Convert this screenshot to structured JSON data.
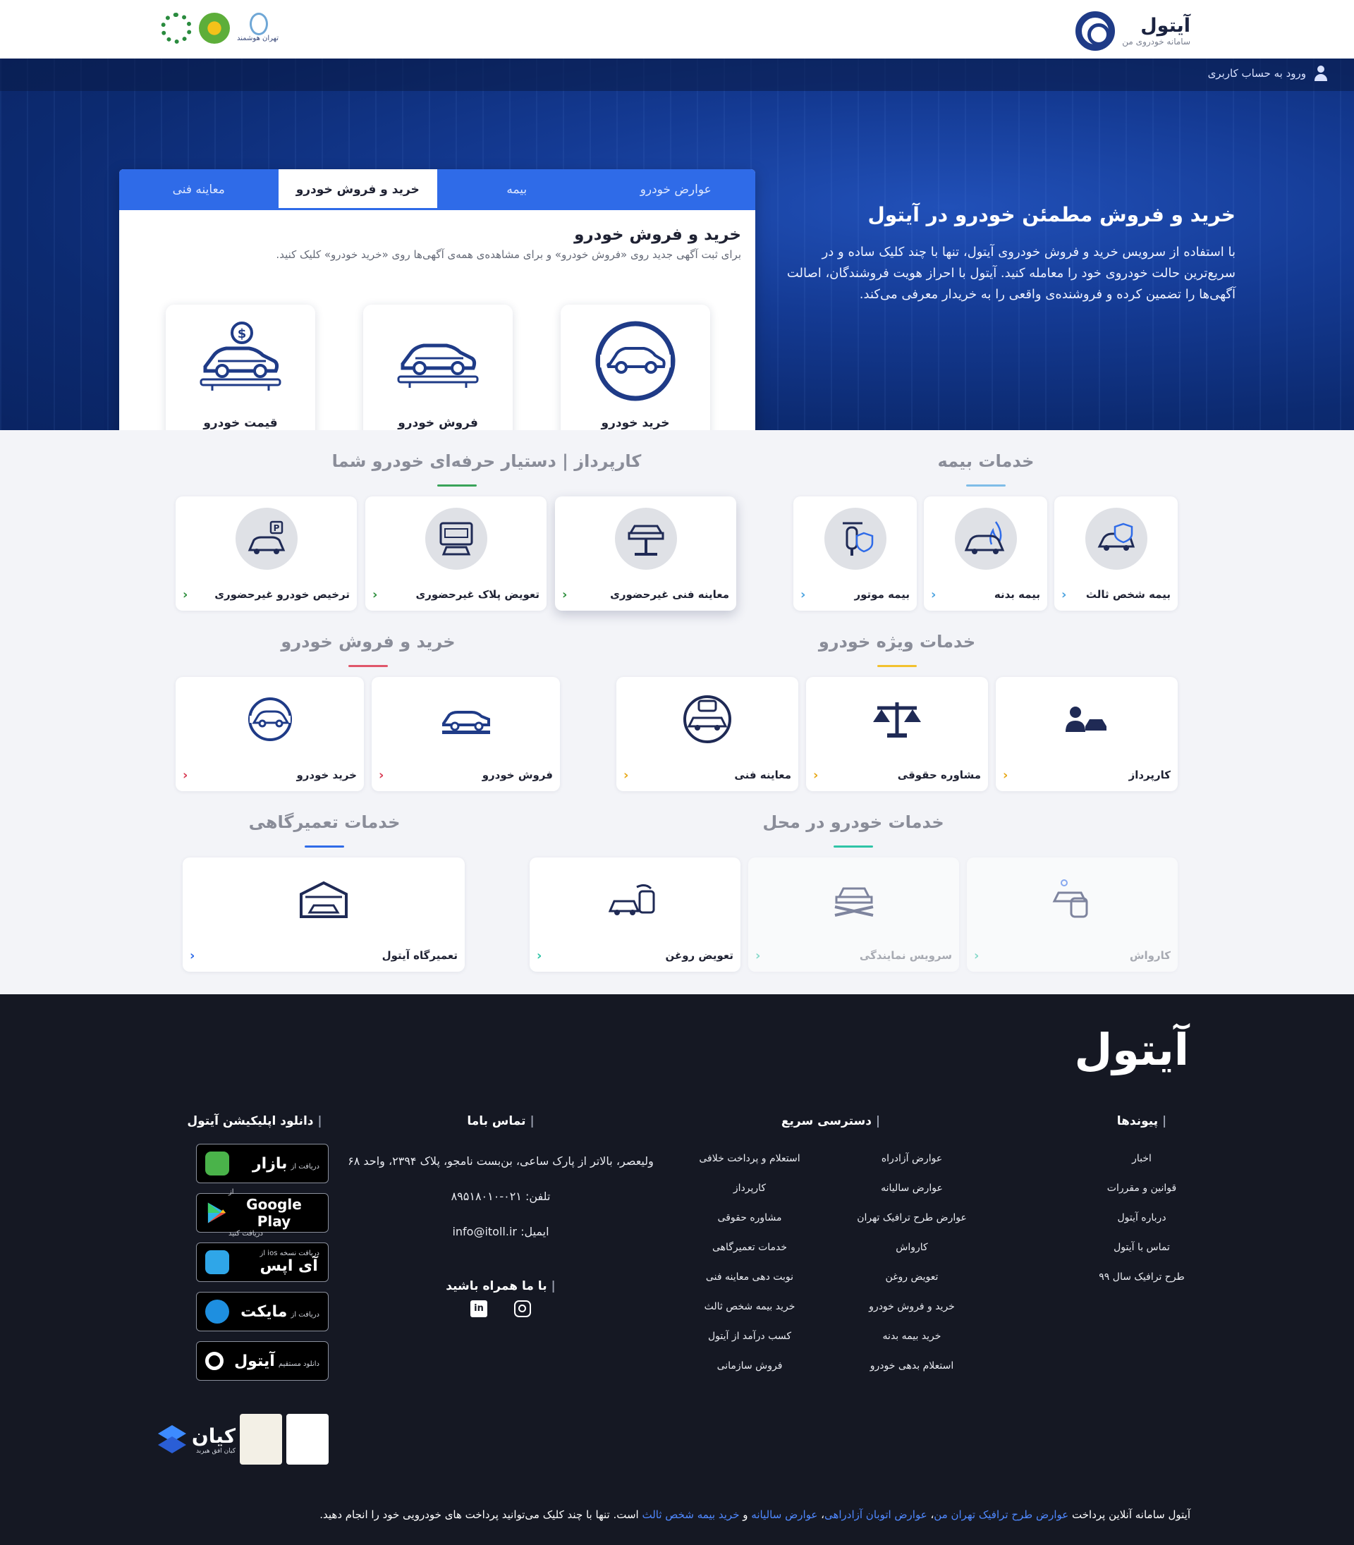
{
  "header": {
    "brand_name": "آیتول",
    "brand_tagline": "سامانه خودروی من",
    "partner_text": "تهران هوشمند"
  },
  "hero": {
    "login_label": "ورود به حساب کاربری",
    "title": "خرید و فروش مطمئن خودرو در آیتول",
    "description": "با استفاده از سرویس خرید و فروش خودروی آیتول، تنها با چند کلیک ساده و در سریع‌ترین حالت خودروی خود را معامله کنید. آیتول با احراز هویت فروشندگان، اصالت آگهی‌ها را تضمین کرده و فروشنده‌ی واقعی را به خریدار معرفی می‌کند."
  },
  "tabs": {
    "items": [
      "عوارض خودرو",
      "بیمه",
      "خرید و فروش خودرو",
      "معاینه فنی"
    ],
    "active_index": 2,
    "panel_title": "خرید و فروش خودرو",
    "panel_desc": "برای ثبت آگهی جدید روی «فروش خودرو» و برای مشاهده‌ی همه‌ی آگهی‌ها روی «خرید خودرو» کلیک کنید.",
    "cards": [
      "خرید خودرو",
      "فروش خودرو",
      "قیمت خودرو"
    ]
  },
  "sections": {
    "insurance": {
      "title": "خدمات بیمه",
      "accent": "#7fbde8",
      "items": [
        "بیمه شخص ثالث",
        "بیمه بدنه",
        "بیمه موتور"
      ]
    },
    "karpardaz": {
      "title": "کارپرداز | دستیار حرفه‌ای خودرو شما",
      "accent": "#3aa35a",
      "items": [
        "معاینه فنی غیرحضوری",
        "تعویض پلاک غیرحضوری",
        "ترخیص خودرو غیرحضوری"
      ]
    },
    "special": {
      "title": "خدمات ویژه خودرو",
      "accent": "#f2c12e",
      "items": [
        "کارپرداز",
        "مشاوره حقوقی",
        "معاینه فنی"
      ]
    },
    "trade": {
      "title": "خرید و فروش خودرو",
      "accent": "#e0566a",
      "items": [
        "فروش خودرو",
        "خرید خودرو"
      ]
    },
    "onsite": {
      "title": "خدمات خودرو در محل",
      "accent": "#2fc4a6",
      "items": [
        "کارواش",
        "سرویس نمایندگی",
        "تعویض روغن"
      ]
    },
    "repair": {
      "title": "خدمات تعمیرگاهی",
      "accent": "#2f6be8",
      "items": [
        "تعمیرگاه آیتول"
      ]
    }
  },
  "footer": {
    "logo": "آیتول",
    "links_title": "پیوندها",
    "links": [
      "اخبار",
      "قوانین و مقررات",
      "درباره آیتول",
      "تماس با آیتول",
      "طرح ترافیک سال ۹۹"
    ],
    "quick_title": "دسترسی سریع",
    "quick_right": [
      "عوارض آزادراه",
      "عوارض سالیانه",
      "عوارض طرح ترافیک تهران",
      "کارواش",
      "تعویض روغن",
      "خرید و فروش خودرو",
      "خرید بیمه بدنه",
      "استعلام بدهی خودرو"
    ],
    "quick_left": [
      "استعلام و پرداخت خلافی",
      "کارپرداز",
      "مشاوره حقوقی",
      "خدمات تعمیرگاهی",
      "نوبت دهی معاینه فنی",
      "خرید بیمه شخص ثالث",
      "کسب درآمد از آیتول",
      "فروش سازمانی"
    ],
    "contact_title": "تماس باما",
    "address": "ولیعصر، بالاتر از پارک ساعی، بن‌بست نامجو، پلاک ۲۳۹۴، واحد ۶۸",
    "phone_label": "تلفن:",
    "phone": "۰۲۱-۸۹۵۱۸۰۱۰",
    "email_label": "ایمیل:",
    "email": "info@itoll.ir",
    "social_title": "با ما همراه باشید",
    "apps_title": "دانلود اپلیکیشن آیتول",
    "stores": [
      {
        "small": "دریافت از",
        "big": "بازار"
      },
      {
        "small": "از",
        "big": "Google Play",
        "small2": "دریافت کنید"
      },
      {
        "small": "دریافت نسخه ios از",
        "big": "آی اپس"
      },
      {
        "small": "دریافت از",
        "big": "مایکت"
      },
      {
        "small": "دانلود مستقیم",
        "big": "آیتول"
      }
    ],
    "badge_brand": "کیان",
    "badge_sub": "کیان افق هیربد",
    "note_prefix": "آیتول سامانه آنلاین پرداخت",
    "note_link1": "عوارض طرح ترافیک تهران من",
    "note_link2": "عوارض اتوبان آزادراهی",
    "note_link3": "عوارض سالیانه",
    "note_and": "و",
    "note_link4": "خرید بیمه شخص ثالث",
    "note_suffix": "است. تنها با چند کلیک می‌توانید پرداخت های خودرویی خود را انجام دهید."
  },
  "colors": {
    "primary": "#2f6be8",
    "navy": "#1f3b87",
    "footer_bg": "#151823",
    "section_bg": "#f3f4f8"
  }
}
